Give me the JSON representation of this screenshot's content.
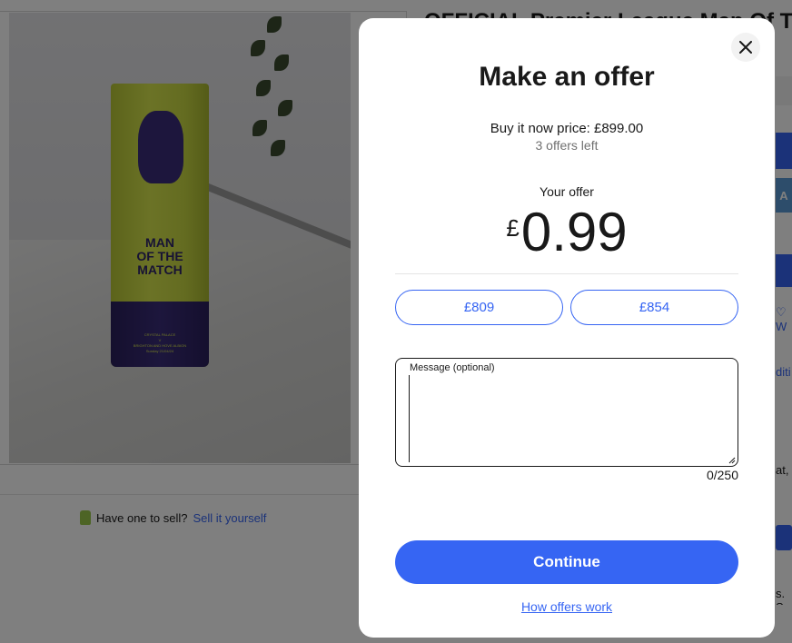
{
  "background": {
    "listing_title": "OFFICIAL Premier League Man Of The",
    "product_photo": {
      "tube_text": "MAN\nOF THE\nMATCH",
      "tube_small_text": "CRYSTAL PALACE\nV\nBRIGHTON AND HOVE ALBION\nSunday 21/04/24"
    },
    "sell_prompt": "Have one to sell?",
    "sell_link": "Sell it yourself",
    "right_stubs": {
      "a_label": "A",
      "watch_glyph": "♡ W",
      "link_fragment": "diti",
      "text_fragment_1": "at,",
      "text_fragment_2": "s. S"
    }
  },
  "modal": {
    "title": "Make an offer",
    "buy_it_now_price": "Buy it now price: £899.00",
    "offers_left": "3 offers left",
    "your_offer_label": "Your offer",
    "offer_currency": "£",
    "offer_value": "0.99",
    "suggested_offers": [
      "£809",
      "£854"
    ],
    "message": {
      "label": "Message (optional)",
      "value": "",
      "char_count": "0/250"
    },
    "continue_label": "Continue",
    "how_offers_work_label": "How offers work",
    "close_icon": "close-icon"
  },
  "colors": {
    "accent": "#3665f3",
    "overlay": "rgba(0,0,0,0.5)",
    "text": "#191919",
    "muted": "#707070"
  }
}
